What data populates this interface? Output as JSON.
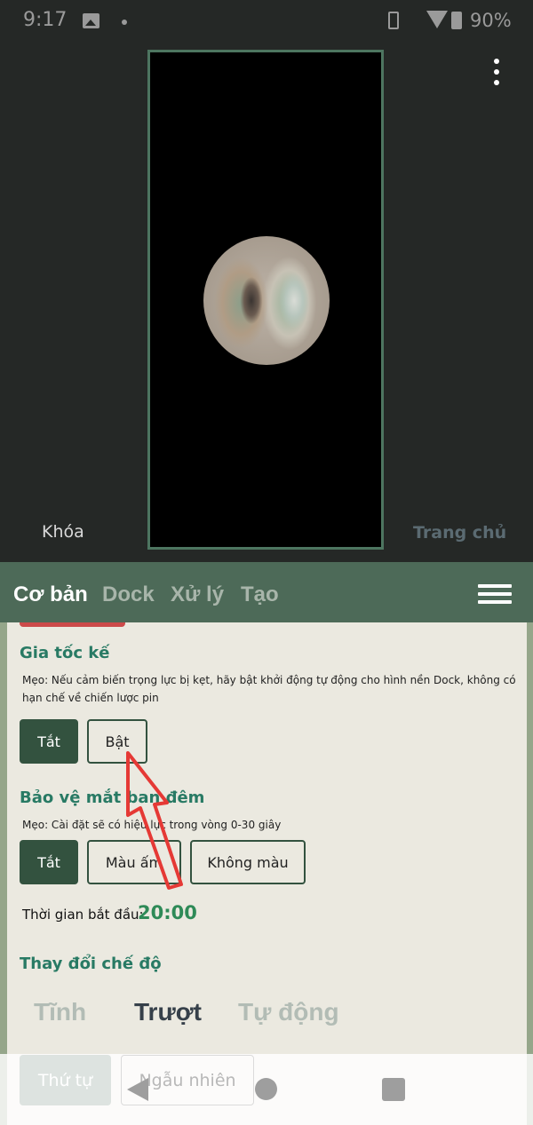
{
  "status_bar": {
    "time": "9:17",
    "battery": "90%"
  },
  "preview": {
    "lock_label": "Khóa",
    "home_label": "Trang chủ"
  },
  "tabs": [
    {
      "label": "Cơ bản",
      "active": true
    },
    {
      "label": "Dock",
      "active": false
    },
    {
      "label": "Xử lý",
      "active": false
    },
    {
      "label": "Tạo",
      "active": false
    }
  ],
  "accelerometer": {
    "title": "Gia tốc kế",
    "tip": "Mẹo: Nếu cảm biến trọng lực bị kẹt, hãy bật khởi động tự động cho hình nền Dock, không có hạn chế về chiến lược pin",
    "options": {
      "off": "Tắt",
      "on": "Bật"
    },
    "selected": "Tắt"
  },
  "night_eye": {
    "title": "Bảo vệ mắt ban đêm",
    "tip": "Mẹo: Cài đặt sẽ có hiệu lực trong vòng 0-30 giây",
    "options": {
      "off": "Tắt",
      "warm": "Màu ấm",
      "none": "Không màu"
    },
    "selected": "Tắt",
    "start_label": "Thời gian bắt đầu:",
    "start_value": "20:00"
  },
  "mode_change": {
    "title": "Thay đổi chế độ",
    "modes": {
      "static": "Tĩnh",
      "slide": "Trượt",
      "auto": "Tự động"
    },
    "selected": "Trượt"
  },
  "order": {
    "sequential": "Thứ tự",
    "random": "Ngẫu nhiên"
  },
  "colors": {
    "accent": "#33523f",
    "tab_bar": "#4d6a58",
    "title": "#287a64",
    "time": "#2e8a57",
    "arrow": "#e53935"
  }
}
